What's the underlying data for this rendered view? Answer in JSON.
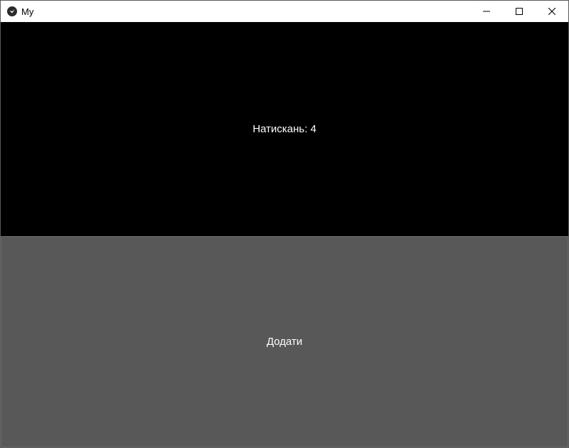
{
  "window": {
    "title": "My",
    "app_icon": "kivy-logo-icon",
    "controls": {
      "minimize_icon": "minimize-icon",
      "maximize_icon": "maximize-icon",
      "close_icon": "close-icon"
    }
  },
  "main": {
    "counter_label": "Натискань: 4",
    "add_button_label": "Додати"
  },
  "colors": {
    "background": "#000000",
    "button": "#585858",
    "text": "#ffffff"
  }
}
